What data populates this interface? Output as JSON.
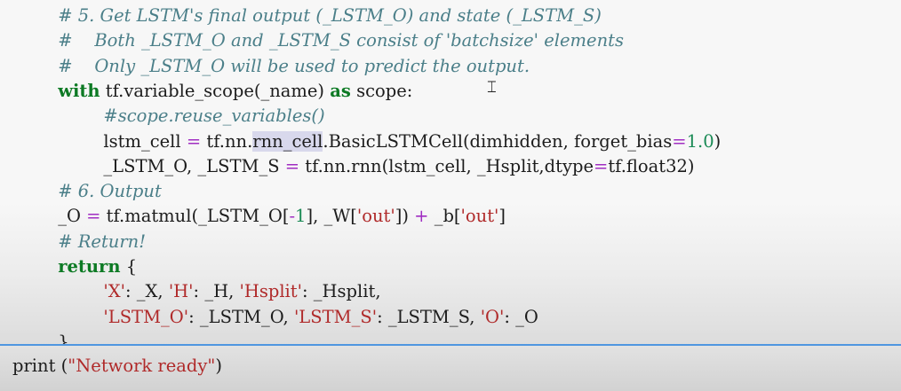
{
  "code_cell": {
    "lines": [
      {
        "indent": "    ",
        "tokens": [
          {
            "text": "# 5. Get LSTM's final output (_LSTM_O) and state (_LSTM_S)",
            "kind": "comment"
          }
        ]
      },
      {
        "indent": "    ",
        "tokens": [
          {
            "text": "#    Both _LSTM_O and _LSTM_S consist of 'batchsize' elements",
            "kind": "comment"
          }
        ]
      },
      {
        "indent": "    ",
        "tokens": [
          {
            "text": "#    Only _LSTM_O will be used to predict the output.",
            "kind": "comment"
          }
        ]
      },
      {
        "indent": "    ",
        "tokens": [
          {
            "text": "with",
            "kind": "keyword"
          },
          {
            "text": " tf.variable_scope(_name) ",
            "kind": "text"
          },
          {
            "text": "as",
            "kind": "keyword"
          },
          {
            "text": " scope:",
            "kind": "text"
          }
        ]
      },
      {
        "indent": "        ",
        "tokens": [
          {
            "text": "#scope.reuse_variables()",
            "kind": "comment"
          }
        ]
      },
      {
        "indent": "        ",
        "tokens": [
          {
            "text": "lstm_cell ",
            "kind": "text"
          },
          {
            "text": "=",
            "kind": "op"
          },
          {
            "text": " tf.nn.",
            "kind": "text"
          },
          {
            "text": "rnn_cell",
            "kind": "highlight"
          },
          {
            "text": ".BasicLSTMCell(dimhidden, forget_bias",
            "kind": "text"
          },
          {
            "text": "=",
            "kind": "op"
          },
          {
            "text": "1.0",
            "kind": "number"
          },
          {
            "text": ")",
            "kind": "text"
          }
        ]
      },
      {
        "indent": "        ",
        "tokens": [
          {
            "text": "_LSTM_O, _LSTM_S ",
            "kind": "text"
          },
          {
            "text": "=",
            "kind": "op"
          },
          {
            "text": " tf.nn.rnn(lstm_cell, _Hsplit,dtype",
            "kind": "text"
          },
          {
            "text": "=",
            "kind": "op"
          },
          {
            "text": "tf.float32)",
            "kind": "text"
          }
        ]
      },
      {
        "indent": "    ",
        "tokens": [
          {
            "text": "# 6. Output",
            "kind": "comment"
          }
        ]
      },
      {
        "indent": "    ",
        "tokens": [
          {
            "text": "_O ",
            "kind": "text"
          },
          {
            "text": "=",
            "kind": "op"
          },
          {
            "text": " tf.matmul(_LSTM_O[",
            "kind": "text"
          },
          {
            "text": "-",
            "kind": "op"
          },
          {
            "text": "1",
            "kind": "number"
          },
          {
            "text": "], _W[",
            "kind": "text"
          },
          {
            "text": "'out'",
            "kind": "string"
          },
          {
            "text": "]) ",
            "kind": "text"
          },
          {
            "text": "+",
            "kind": "op"
          },
          {
            "text": " _b[",
            "kind": "text"
          },
          {
            "text": "'out'",
            "kind": "string"
          },
          {
            "text": "]",
            "kind": "text"
          }
        ]
      },
      {
        "indent": "    ",
        "tokens": [
          {
            "text": "# Return!",
            "kind": "comment"
          }
        ]
      },
      {
        "indent": "    ",
        "tokens": [
          {
            "text": "return",
            "kind": "keyword"
          },
          {
            "text": " {",
            "kind": "text"
          }
        ]
      },
      {
        "indent": "        ",
        "tokens": [
          {
            "text": "'X'",
            "kind": "string"
          },
          {
            "text": ": _X, ",
            "kind": "text"
          },
          {
            "text": "'H'",
            "kind": "string"
          },
          {
            "text": ": _H, ",
            "kind": "text"
          },
          {
            "text": "'Hsplit'",
            "kind": "string"
          },
          {
            "text": ": _Hsplit,",
            "kind": "text"
          }
        ]
      },
      {
        "indent": "        ",
        "tokens": [
          {
            "text": "'LSTM_O'",
            "kind": "string"
          },
          {
            "text": ": _LSTM_O, ",
            "kind": "text"
          },
          {
            "text": "'LSTM_S'",
            "kind": "string"
          },
          {
            "text": ": _LSTM_S, ",
            "kind": "text"
          },
          {
            "text": "'O'",
            "kind": "string"
          },
          {
            "text": ": _O",
            "kind": "text"
          }
        ]
      },
      {
        "indent": "    ",
        "tokens": [
          {
            "text": "}",
            "kind": "text"
          }
        ]
      }
    ]
  },
  "print_cell": {
    "tokens": [
      {
        "text": "print",
        "kind": "text"
      },
      {
        "text": " (",
        "kind": "text"
      },
      {
        "text": "\"Network ready\"",
        "kind": "string"
      },
      {
        "text": ")",
        "kind": "text"
      }
    ]
  },
  "colors": {
    "comment": "#4b7f89",
    "keyword": "#0d7a24",
    "string": "#b02a2a",
    "number": "#1a8a55",
    "operator": "#a02dc2",
    "selection_highlight": "#d8d8ec",
    "cell_divider": "#4f96e0"
  },
  "cursor": {
    "icon": "i-beam-cursor-icon"
  }
}
